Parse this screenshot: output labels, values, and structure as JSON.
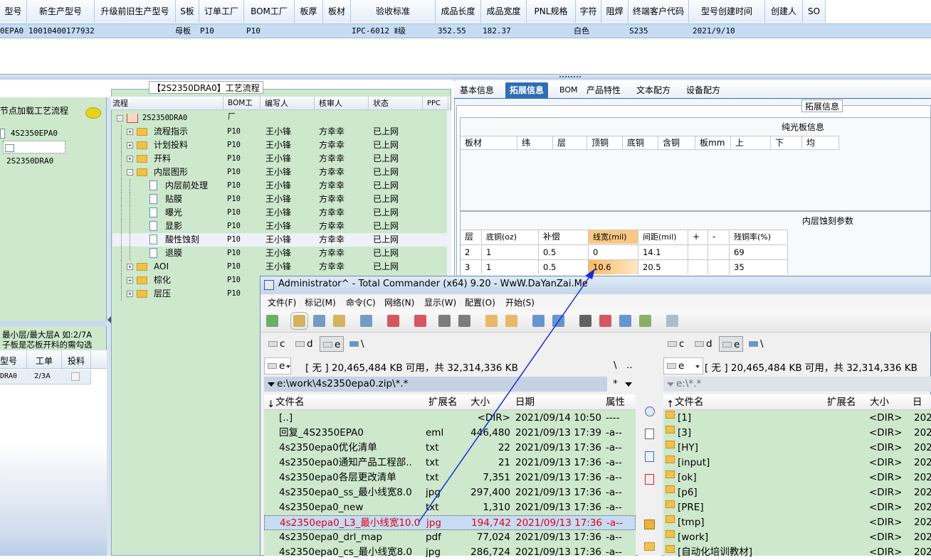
{
  "top_grid": {
    "headers": [
      "型号",
      "新生产型号",
      "升级前旧生产型号",
      "S板",
      "订单工厂",
      "BOM工厂",
      "板厚",
      "板材",
      "验收标准",
      "成品长度",
      "成品宽度",
      "PNL规格",
      "字符",
      "阻焊",
      "终端客户代码",
      "型号创建时间",
      "创建人",
      "SO"
    ],
    "row": {
      "model": "0EPA0",
      "new_model": "10010400177932",
      "s_board": "母板",
      "order_factory": "P10",
      "bom_factory": "P10",
      "standard": "IPC-6012 Ⅱ级",
      "length": "352.55",
      "width": "182.37",
      "solder": "白色",
      "customer": "S235",
      "created": "2021/9/10"
    }
  },
  "left_panel": {
    "header": "节点加载工艺流程",
    "items": [
      "4S2350EPA0",
      "2S2350DRA0"
    ],
    "note_line1": "最小层/最大层A 如:2/7A",
    "note_line2": "子板是芯板开料的需勾选",
    "grid_headers": [
      "型号",
      "工单",
      "投料"
    ],
    "grid_row": {
      "model": "DRA0",
      "order": "2/3A"
    }
  },
  "process": {
    "title": "【2S2350DRA0】工艺流程",
    "headers": [
      "流程",
      "BOM工厂",
      "编写人",
      "核审人",
      "状态",
      "PPC"
    ],
    "root": "2S2350DRA0",
    "rows": [
      {
        "name": "流程指示",
        "bom": "P10",
        "writer": "王小锋",
        "reviewer": "方幸幸",
        "status": "已上网",
        "type": "folder",
        "level": 1,
        "exp": "+"
      },
      {
        "name": "计划投料",
        "bom": "P10",
        "writer": "王小锋",
        "reviewer": "方幸幸",
        "status": "已上网",
        "type": "folder",
        "level": 1,
        "exp": "+"
      },
      {
        "name": "开料",
        "bom": "P10",
        "writer": "王小锋",
        "reviewer": "方幸幸",
        "status": "已上网",
        "type": "folder",
        "level": 1,
        "exp": "+"
      },
      {
        "name": "内层图形",
        "bom": "P10",
        "writer": "王小锋",
        "reviewer": "方幸幸",
        "status": "已上网",
        "type": "folder",
        "level": 1,
        "exp": "-"
      },
      {
        "name": "内层前处理",
        "bom": "P10",
        "writer": "王小锋",
        "reviewer": "方幸幸",
        "status": "已上网",
        "type": "doc",
        "level": 2,
        "exp": ""
      },
      {
        "name": "贴膜",
        "bom": "P10",
        "writer": "王小锋",
        "reviewer": "方幸幸",
        "status": "已上网",
        "type": "doc",
        "level": 2,
        "exp": ""
      },
      {
        "name": "曝光",
        "bom": "P10",
        "writer": "王小锋",
        "reviewer": "方幸幸",
        "status": "已上网",
        "type": "doc",
        "level": 2,
        "exp": ""
      },
      {
        "name": "显影",
        "bom": "P10",
        "writer": "王小锋",
        "reviewer": "方幸幸",
        "status": "已上网",
        "type": "doc",
        "level": 2,
        "exp": ""
      },
      {
        "name": "酸性蚀刻",
        "bom": "P10",
        "writer": "王小锋",
        "reviewer": "方幸幸",
        "status": "已上网",
        "type": "doc",
        "level": 2,
        "exp": ""
      },
      {
        "name": "退膜",
        "bom": "P10",
        "writer": "王小锋",
        "reviewer": "方幸幸",
        "status": "已上网",
        "type": "doc",
        "level": 2,
        "exp": ""
      },
      {
        "name": "AOI",
        "bom": "P10",
        "writer": "王小锋",
        "reviewer": "方幸幸",
        "status": "已上网",
        "type": "folder",
        "level": 1,
        "exp": "+"
      },
      {
        "name": "棕化",
        "bom": "P10",
        "writer": "",
        "reviewer": "",
        "status": "",
        "type": "folder",
        "level": 1,
        "exp": "+"
      },
      {
        "name": "层压",
        "bom": "P10",
        "writer": "",
        "reviewer": "",
        "status": "",
        "type": "folder",
        "level": 1,
        "exp": "+"
      }
    ]
  },
  "right_panel": {
    "tabs": [
      "基本信息",
      "拓展信息",
      "BOM",
      "产品特性",
      "文本配方",
      "设备配方"
    ],
    "section_label": "拓展信息",
    "board_title": "纯光板信息",
    "board_headers": [
      "板材",
      "纬",
      "层",
      "顶铜",
      "底铜",
      "含铜",
      "板mm",
      "上",
      "下",
      "均"
    ],
    "etch_title": "内层蚀刻参数",
    "etch_headers": [
      "层",
      "底铜(oz)",
      "补偿",
      "线宽(mil)",
      "间距(mil)",
      "+",
      "-",
      "残铜率(%)"
    ],
    "etch_rows": [
      [
        "2",
        "1",
        "0.5",
        "0",
        "14.1",
        "",
        "",
        "69"
      ],
      [
        "3",
        "1",
        "0.5",
        "10.6",
        "20.5",
        "",
        "",
        "35"
      ]
    ]
  },
  "tc": {
    "title": "Administrator^ - Total Commander (x64) 9.20 - WwW.DaYanZai.Me",
    "menu": [
      "文件(F)",
      "标记(M)",
      "命令(C)",
      "网络(N)",
      "显示(W)",
      "配置(O)",
      "开始(S)"
    ],
    "drives": [
      "c",
      "d",
      "e",
      "\\"
    ],
    "free_text": "[ 无 ]  20,465,484 KB 可用，共 32,314,336 KB",
    "left_drive": "e",
    "left_path": "e:\\work\\4s2350epa0.zip\\*.*",
    "right_path": "e:\\*.*",
    "root_btn": "\\",
    "up_btn": "..",
    "star": "*",
    "cols": [
      "文件名",
      "扩展名",
      "大小",
      "日期",
      "属性"
    ],
    "left_files": [
      {
        "name": "[..]",
        "ext": "",
        "size": "<DIR>",
        "date": "2021/09/14 10:50",
        "attr": "----"
      },
      {
        "name": "回复_4S2350EPA0",
        "ext": "eml",
        "size": "446,480",
        "date": "2021/09/13 17:39",
        "attr": "-a--"
      },
      {
        "name": "4s2350epa0优化清单",
        "ext": "txt",
        "size": "22",
        "date": "2021/09/13 17:36",
        "attr": "-a--"
      },
      {
        "name": "4s2350epa0通知产品工程部..",
        "ext": "txt",
        "size": "21",
        "date": "2021/09/13 17:36",
        "attr": "-a--"
      },
      {
        "name": "4s2350epa0各层更改清单",
        "ext": "txt",
        "size": "7,351",
        "date": "2021/09/13 17:36",
        "attr": "-a--"
      },
      {
        "name": "4s2350epa0_ss_最小线宽8.0",
        "ext": "jpg",
        "size": "297,400",
        "date": "2021/09/13 17:36",
        "attr": "-a--"
      },
      {
        "name": "4s2350epa0_new",
        "ext": "txt",
        "size": "1,310",
        "date": "2021/09/13 17:36",
        "attr": "-a--"
      },
      {
        "name": "4s2350epa0_L3_最小线宽10.0",
        "ext": "jpg",
        "size": "194,742",
        "date": "2021/09/13 17:36",
        "attr": "-a--"
      },
      {
        "name": "4s2350epa0_drl_map",
        "ext": "pdf",
        "size": "77,024",
        "date": "2021/09/13 17:36",
        "attr": "-a--"
      },
      {
        "name": "4s2350epa0_cs_最小线宽8.0",
        "ext": "jpg",
        "size": "286,724",
        "date": "2021/09/13 17:36",
        "attr": "-a--"
      }
    ],
    "right_files": [
      "[1]",
      "[3]",
      "[HY]",
      "[input]",
      "[ok]",
      "[p6]",
      "[PRE]",
      "[tmp]",
      "[work]",
      "[自动化培训教材]"
    ],
    "right_dir": "<DIR>",
    "right_date": "202",
    "right_date_header": "日期"
  },
  "colors": {
    "green_bg": "#cde8cd",
    "highlight_row": "#c5dcf3",
    "accent_tab": "#2f6db5",
    "selected_file": "#e0000e"
  }
}
